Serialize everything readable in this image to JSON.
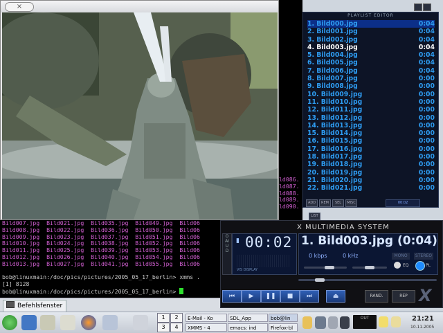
{
  "terminal": {
    "grid_rows": [
      "Bild007.jpg  Bild021.jpg  Bild035.jpg  Bild049.jpg  Bild06",
      "Bild008.jpg  Bild022.jpg  Bild036.jpg  Bild050.jpg  Bild06",
      "Bild009.jpg  Bild023.jpg  Bild037.jpg  Bild051.jpg  Bild06",
      "Bild010.jpg  Bild024.jpg  Bild038.jpg  Bild052.jpg  Bild06",
      "Bild011.jpg  Bild025.jpg  Bild039.jpg  Bild053.jpg  Bild06",
      "Bild012.jpg  Bild026.jpg  Bild040.jpg  Bild054.jpg  Bild06",
      "Bild013.jpg  Bild027.jpg  Bild041.jpg  Bild055.jpg  Bild06"
    ],
    "side_rows": [
      "ld086.",
      "ld087.",
      "ld088.",
      "ld089.",
      "ld090."
    ],
    "prompt1": "bob@linuxmain:/doc/pics/pictures/2005_05_17_berlin> xmms .",
    "job": "[1] 8128",
    "prompt2": "bob@linuxmain:/doc/pics/pictures/2005_05_17_berlin> ",
    "tab_label": "Befehlsfenster"
  },
  "photo_window": {
    "close_symbol": "×"
  },
  "playlist": {
    "title": "PLAYLIST EDITOR",
    "items": [
      {
        "name": "1. Bild000.jpg",
        "time": "0:04"
      },
      {
        "name": "2. Bild001.jpg",
        "time": "0:04"
      },
      {
        "name": "3. Bild002.jpg",
        "time": "0:04"
      },
      {
        "name": "4. Bild003.jpg",
        "time": "0:04"
      },
      {
        "name": "5. Bild004.jpg",
        "time": "0:04"
      },
      {
        "name": "6. Bild005.jpg",
        "time": "0:04"
      },
      {
        "name": "7. Bild006.jpg",
        "time": "0:04"
      },
      {
        "name": "8. Bild007.jpg",
        "time": "0:00"
      },
      {
        "name": "9. Bild008.jpg",
        "time": "0:00"
      },
      {
        "name": "10. Bild009.jpg",
        "time": "0:00"
      },
      {
        "name": "11. Bild010.jpg",
        "time": "0:00"
      },
      {
        "name": "12. Bild011.jpg",
        "time": "0:00"
      },
      {
        "name": "13. Bild012.jpg",
        "time": "0:00"
      },
      {
        "name": "14. Bild013.jpg",
        "time": "0:00"
      },
      {
        "name": "15. Bild014.jpg",
        "time": "0:00"
      },
      {
        "name": "16. Bild015.jpg",
        "time": "0:00"
      },
      {
        "name": "17. Bild016.jpg",
        "time": "0:00"
      },
      {
        "name": "18. Bild017.jpg",
        "time": "0:00"
      },
      {
        "name": "19. Bild018.jpg",
        "time": "0:00"
      },
      {
        "name": "20. Bild019.jpg",
        "time": "0:00"
      },
      {
        "name": "21. Bild020.jpg",
        "time": "0:00"
      },
      {
        "name": "22. Bild021.jpg",
        "time": "0:00"
      }
    ],
    "buttons": [
      "ADD",
      "REM",
      "SEL",
      "MISC"
    ],
    "list_button": "LIST",
    "mini_time": "00:02"
  },
  "xmms": {
    "title": "X MULTIMEDIA SYSTEM",
    "side_label": "OAIUD",
    "time": "00:02",
    "vis_label": "VIS DISPLAY",
    "song": "1. Bild003.jpg (0:04)",
    "kbps": "0 kbps",
    "khz": "0 kHz",
    "mono": "MONO",
    "stereo": "STEREO",
    "eq_label": "EQ",
    "pl_label": "PL",
    "rand_label": "RAND.",
    "rep_label": "REP",
    "logo": "X"
  },
  "taskbar": {
    "pager": [
      "1",
      "2",
      "3",
      "4"
    ],
    "tasks": [
      {
        "label": "E-Mail - Ko"
      },
      {
        "label": "SDL_App"
      },
      {
        "label": "bob@lin"
      },
      {
        "label": "XMMS - 4"
      },
      {
        "label": "emacs: ind"
      },
      {
        "label": "Firefox-bl"
      }
    ],
    "clock": "21:21",
    "date": "10.11.2005",
    "tray_text": "OUT"
  }
}
